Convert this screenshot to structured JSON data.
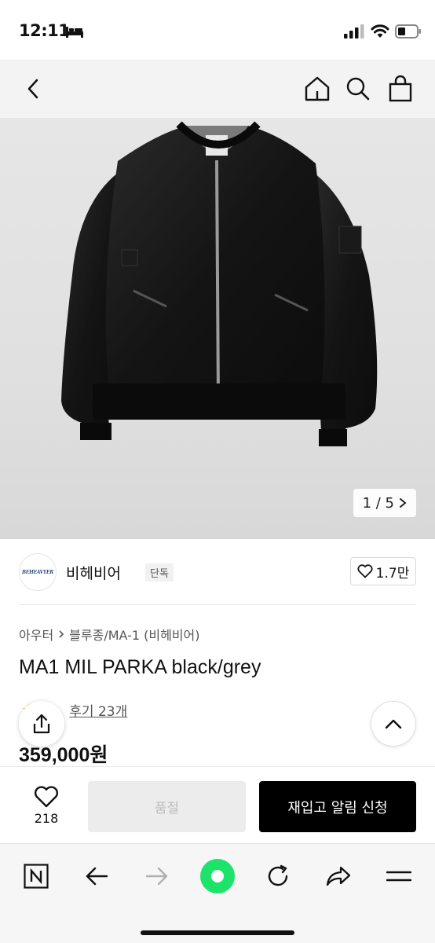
{
  "status_bar": {
    "time": "12:11"
  },
  "header": {
    "back_icon": "chevron-left-icon",
    "home_icon": "home-icon",
    "search_icon": "search-icon",
    "cart_icon": "shopping-bag-icon"
  },
  "gallery": {
    "counter": "1 / 5",
    "current": 1,
    "total": 5
  },
  "brand": {
    "logo_text": "BEHEAVYER",
    "name": "비헤비어",
    "badge": "단독",
    "likes": "1.7만"
  },
  "breadcrumb": {
    "category": "아우터",
    "subcategory": "블루종/MA-1 (비헤비어)"
  },
  "product": {
    "title": "MA1 MIL PARKA black/grey",
    "reviews_label": "후기 23개",
    "price": "359,000원"
  },
  "actions": {
    "wish_count": "218",
    "soldout_label": "품절",
    "restock_label": "재입고 알림 신청"
  },
  "browser": {
    "items": [
      "n-logo-icon",
      "back-arrow-icon",
      "forward-arrow-icon",
      "green-dot-icon",
      "refresh-icon",
      "share-arrow-icon",
      "menu-icon"
    ]
  },
  "colors": {
    "accent": "#000000",
    "browser_green": "#1ee36a",
    "star": "#f4b400"
  }
}
